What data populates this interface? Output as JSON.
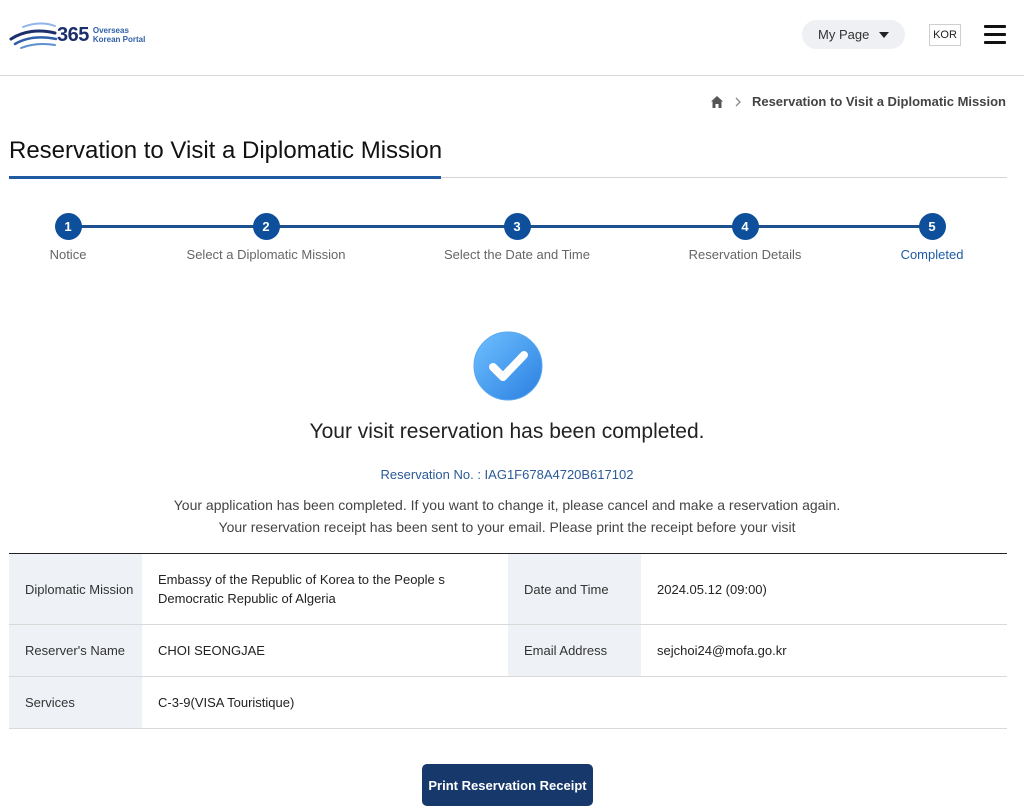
{
  "header": {
    "logo_number": "365",
    "logo_line1": "Overseas",
    "logo_line2": "Korean Portal",
    "mypage_label": "My Page",
    "lang_label": "KOR"
  },
  "breadcrumb": {
    "current": "Reservation to Visit a Diplomatic Mission"
  },
  "page_title": "Reservation to Visit a Diplomatic Mission",
  "steps": [
    {
      "number": "1",
      "label": "Notice"
    },
    {
      "number": "2",
      "label": "Select a Diplomatic Mission"
    },
    {
      "number": "3",
      "label": "Select the Date and Time"
    },
    {
      "number": "4",
      "label": "Reservation Details"
    },
    {
      "number": "5",
      "label": "Completed"
    }
  ],
  "completion": {
    "title": "Your visit reservation has been completed.",
    "reservation_no": "Reservation No. : IAG1F678A4720B617102",
    "message_1": "Your application has been completed. If you want to change it, please cancel and make a reservation again.",
    "message_2": "Your reservation receipt has been sent to your email. Please print the receipt before your visit"
  },
  "details": {
    "mission_label": "Diplomatic Mission",
    "mission_line1": "Embassy of the Republic of Korea to the People s",
    "mission_line2": "Democratic Republic of Algeria",
    "datetime_label": "Date and Time",
    "datetime_value": "2024.05.12 (09:00)",
    "name_label": "Reserver's Name",
    "name_value": "CHOI SEONGJAE",
    "email_label": "Email Address",
    "email_value": "sejchoi24@mofa.go.kr",
    "services_label": "Services",
    "services_value": "C-3-9(VISA Touristique)"
  },
  "print_button": "Print Reservation Receipt",
  "colors": {
    "primary": "#0e4f9c",
    "button": "#17386a",
    "accent_text": "#1f5aa3",
    "table_header_bg": "#eef1f5"
  }
}
